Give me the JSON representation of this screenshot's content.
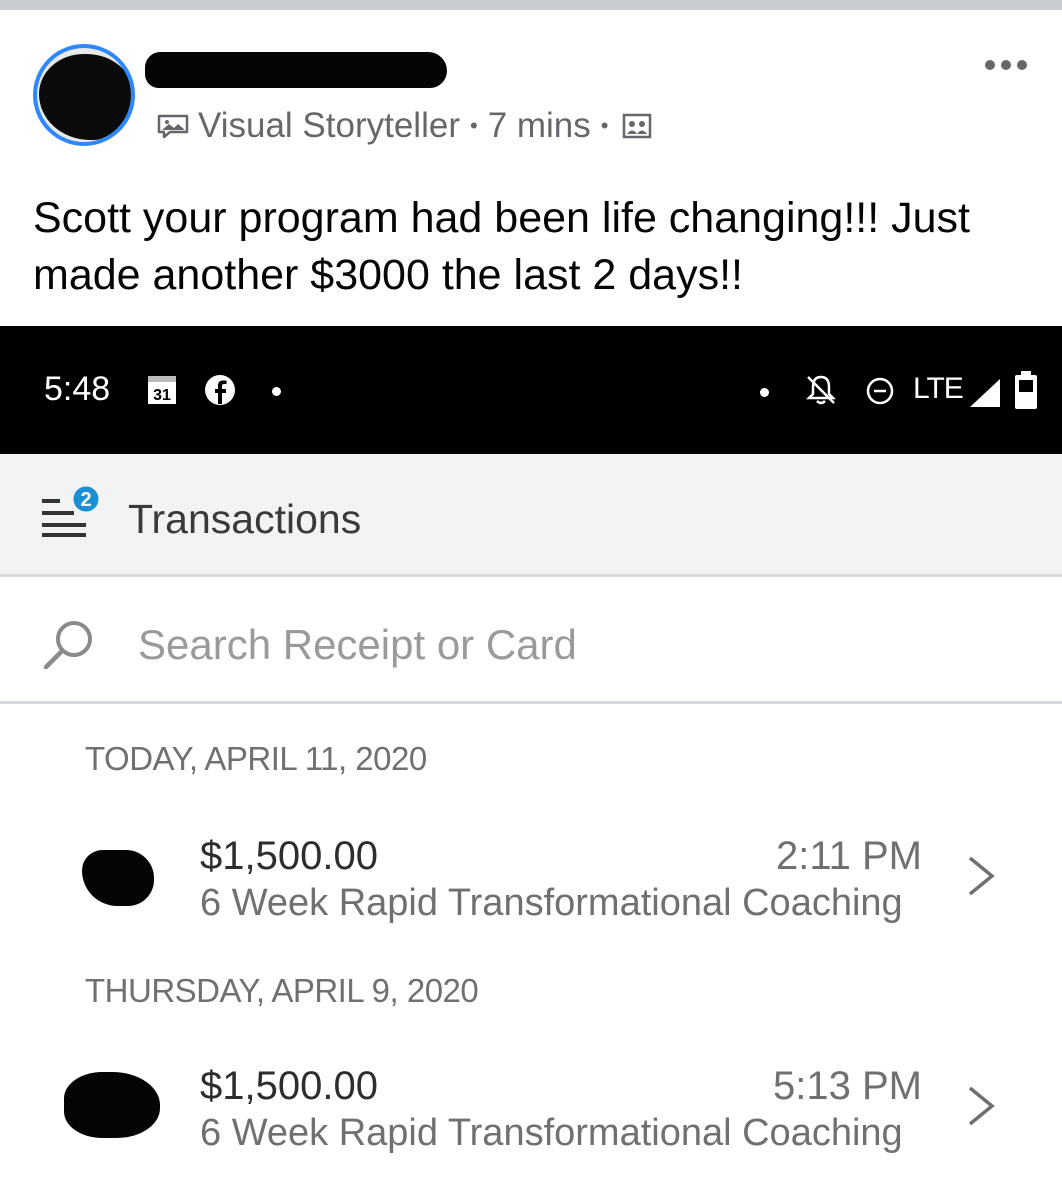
{
  "post": {
    "author_badge": "Visual Storyteller",
    "separator": "•",
    "timestamp": "7 mins",
    "text": "Scott your program had been life changing!!! Just made another $3000 the last 2 days!!",
    "icons": [
      "visual-storyteller-badge-icon",
      "audience-icon",
      "more-options-icon"
    ]
  },
  "screenshot": {
    "status_bar": {
      "time": "5:48",
      "calendar_day": "31",
      "network": "LTE",
      "icons": [
        "calendar-icon",
        "facebook-icon",
        "notifications-off-icon",
        "do-not-disturb-icon",
        "signal-icon",
        "battery-icon"
      ]
    },
    "header": {
      "title": "Transactions",
      "badge_count": "2"
    },
    "search": {
      "placeholder": "Search Receipt or Card"
    },
    "groups": [
      {
        "date": "TODAY, APRIL 11, 2020",
        "transactions": [
          {
            "amount": "$1,500.00",
            "time": "2:11 PM",
            "description": "6 Week Rapid Transformational Coaching"
          }
        ]
      },
      {
        "date": "THURSDAY, APRIL 9, 2020",
        "transactions": [
          {
            "amount": "$1,500.00",
            "time": "5:13 PM",
            "description": "6 Week Rapid Transformational Coaching"
          }
        ]
      }
    ]
  },
  "colors": {
    "facebook_blue": "#2d88ff",
    "meta_gray": "#65676b",
    "badge_blue": "#1b8fd4"
  }
}
